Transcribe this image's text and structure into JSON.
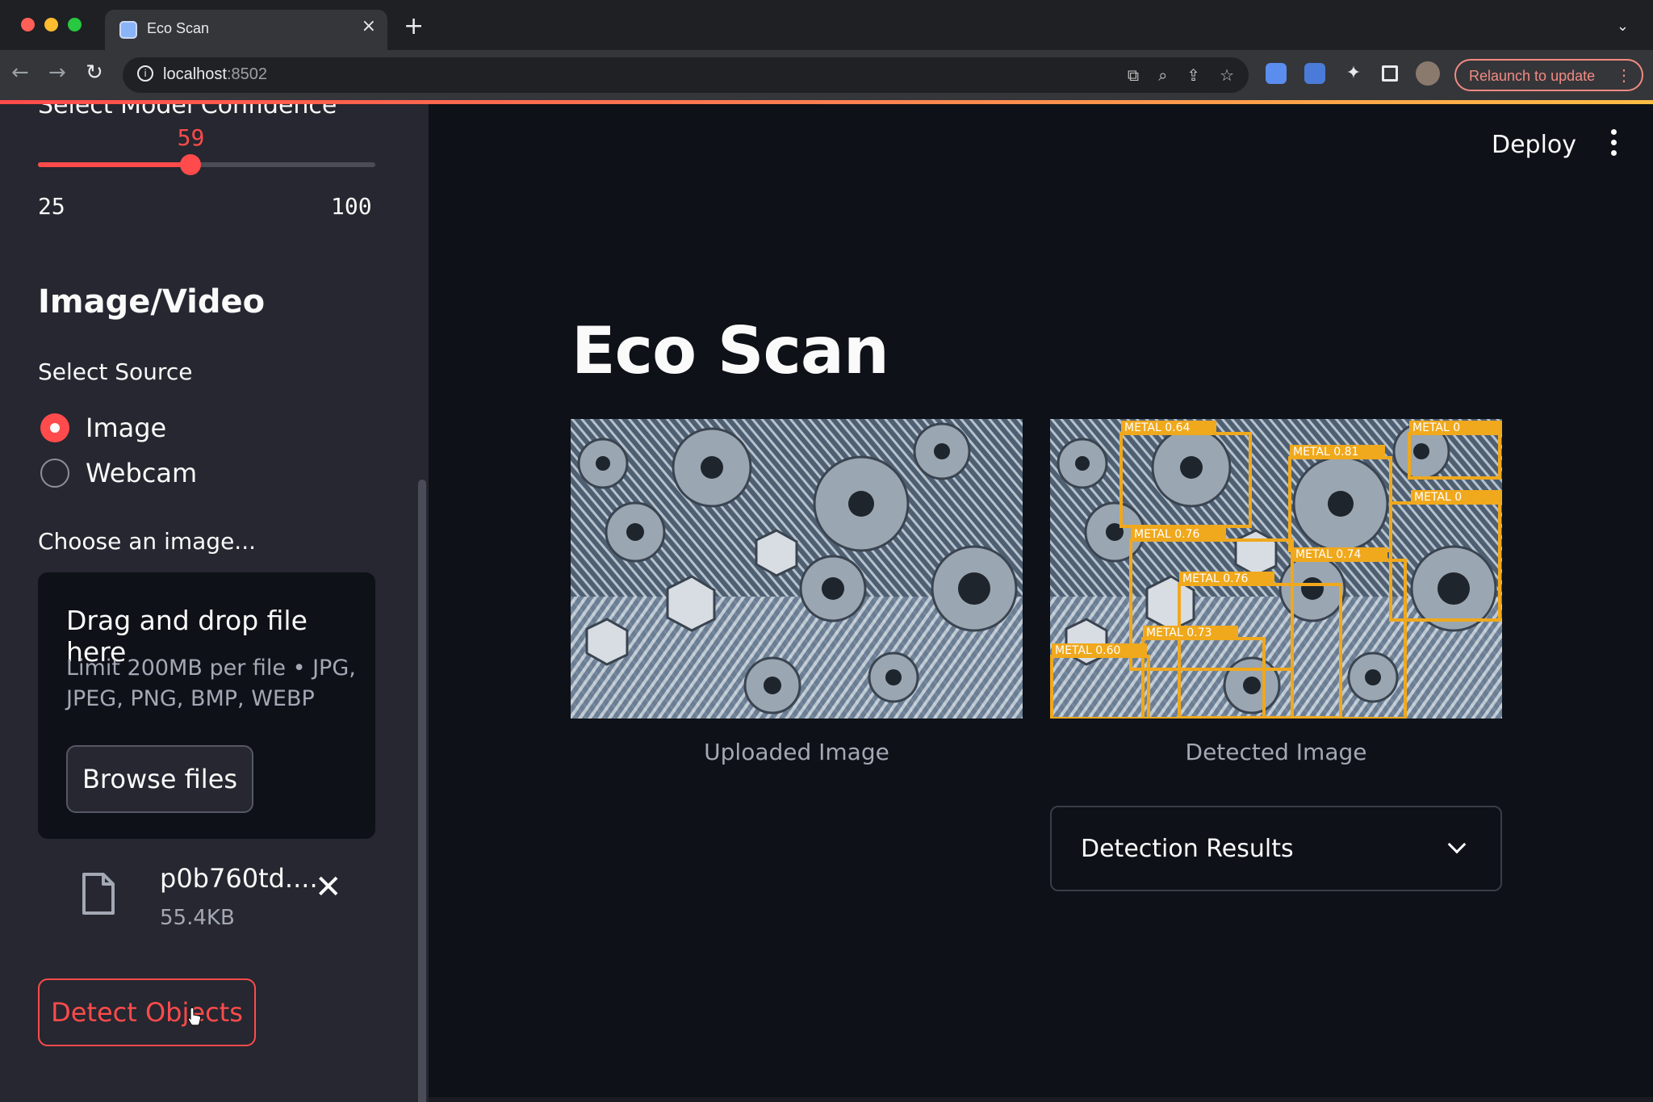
{
  "browser": {
    "tab_title": "Eco Scan",
    "tab_close": "×",
    "new_tab": "+",
    "url_host": "localhost",
    "url_port": ":8502",
    "relaunch_label": "Relaunch to update"
  },
  "sidebar": {
    "cut_label": "Select Model Confidence",
    "confidence": {
      "value": 59,
      "min": 25,
      "max": 100,
      "value_label": "59",
      "min_label": "25",
      "max_label": "100"
    },
    "section_title": "Image/Video",
    "source_label": "Select Source",
    "source_options": [
      "Image",
      "Webcam"
    ],
    "selected_source": "Image",
    "uploader": {
      "label": "Choose an image...",
      "drop_title": "Drag and drop file here",
      "limit_text": "Limit 200MB per file • JPG, JPEG, PNG, BMP, WEBP",
      "browse_label": "Browse files"
    },
    "uploaded_file": {
      "name": "p0b760td....",
      "size": "55.4KB"
    },
    "detect_label": "Detect Objects"
  },
  "header": {
    "deploy_label": "Deploy"
  },
  "main": {
    "title": "Eco Scan",
    "uploaded_caption": "Uploaded Image",
    "detected_caption": "Detected Image",
    "detections": [
      {
        "label": "METAL 0.64"
      },
      {
        "label": "METAL 0.81"
      },
      {
        "label": "METAL 0"
      },
      {
        "label": "METAL 0"
      },
      {
        "label": "METAL 0.76"
      },
      {
        "label": "METAL 0.74"
      },
      {
        "label": "METAL 0.76"
      },
      {
        "label": "METAL 0.73"
      },
      {
        "label": "METAL 0.60"
      }
    ],
    "results_label": "Detection Results"
  },
  "colors": {
    "accent": "#ff4b4b",
    "sidebar_bg": "#262730",
    "main_bg": "#0e1117",
    "detection_box": "#f0a81c"
  }
}
